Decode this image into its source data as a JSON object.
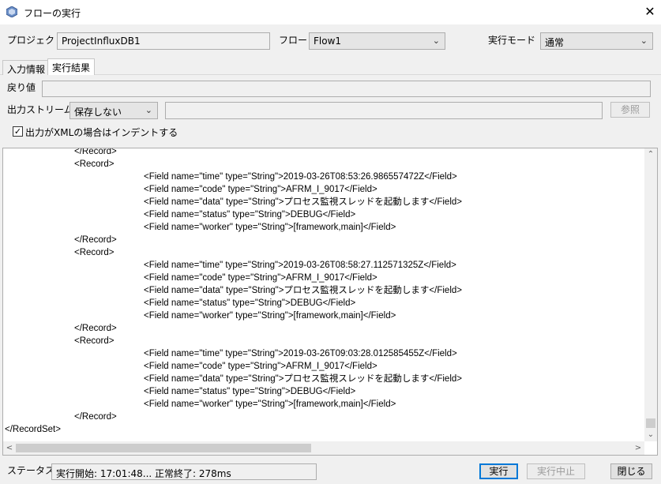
{
  "window": {
    "title": "フローの実行",
    "close_glyph": "✕"
  },
  "project": {
    "label": "プロジェクト",
    "value": "ProjectInfluxDB1"
  },
  "flow": {
    "label": "フロー",
    "value": "Flow1"
  },
  "mode": {
    "label": "実行モード",
    "value": "通常"
  },
  "tabs": [
    {
      "label": "入力情報",
      "active": false
    },
    {
      "label": "実行結果",
      "active": true
    }
  ],
  "return_value": {
    "label": "戻り値",
    "value": ""
  },
  "output_stream": {
    "label": "出力ストリーム",
    "value": "保存しない",
    "path": "",
    "browse_label": "参照"
  },
  "indent": {
    "label": "出力がXMLの場合はインデントする",
    "checked": true,
    "check_glyph": "✓"
  },
  "xml": {
    "lines": [
      {
        "indent": 1,
        "text": "</Record>"
      },
      {
        "indent": 1,
        "text": "<Record>"
      },
      {
        "indent": 2,
        "text": "<Field name=\"time\" type=\"String\">2019-03-26T08:53:26.986557472Z</Field>"
      },
      {
        "indent": 2,
        "text": "<Field name=\"code\" type=\"String\">AFRM_I_9017</Field>"
      },
      {
        "indent": 2,
        "text": "<Field name=\"data\" type=\"String\">プロセス監視スレッドを起動します</Field>"
      },
      {
        "indent": 2,
        "text": "<Field name=\"status\" type=\"String\">DEBUG</Field>"
      },
      {
        "indent": 2,
        "text": "<Field name=\"worker\" type=\"String\">[framework,main]</Field>"
      },
      {
        "indent": 1,
        "text": "</Record>"
      },
      {
        "indent": 1,
        "text": "<Record>"
      },
      {
        "indent": 2,
        "text": "<Field name=\"time\" type=\"String\">2019-03-26T08:58:27.112571325Z</Field>"
      },
      {
        "indent": 2,
        "text": "<Field name=\"code\" type=\"String\">AFRM_I_9017</Field>"
      },
      {
        "indent": 2,
        "text": "<Field name=\"data\" type=\"String\">プロセス監視スレッドを起動します</Field>"
      },
      {
        "indent": 2,
        "text": "<Field name=\"status\" type=\"String\">DEBUG</Field>"
      },
      {
        "indent": 2,
        "text": "<Field name=\"worker\" type=\"String\">[framework,main]</Field>"
      },
      {
        "indent": 1,
        "text": "</Record>"
      },
      {
        "indent": 1,
        "text": "<Record>"
      },
      {
        "indent": 2,
        "text": "<Field name=\"time\" type=\"String\">2019-03-26T09:03:28.012585455Z</Field>"
      },
      {
        "indent": 2,
        "text": "<Field name=\"code\" type=\"String\">AFRM_I_9017</Field>"
      },
      {
        "indent": 2,
        "text": "<Field name=\"data\" type=\"String\">プロセス監視スレッドを起動します</Field>"
      },
      {
        "indent": 2,
        "text": "<Field name=\"status\" type=\"String\">DEBUG</Field>"
      },
      {
        "indent": 2,
        "text": "<Field name=\"worker\" type=\"String\">[framework,main]</Field>"
      },
      {
        "indent": 1,
        "text": "</Record>"
      },
      {
        "indent": 0,
        "text": "</RecordSet>"
      }
    ]
  },
  "status": {
    "label": "ステータス",
    "value": "実行開始: 17:01:48... 正常終了: 278ms"
  },
  "buttons": {
    "run": "実行",
    "stop": "実行中止",
    "close": "閉じる"
  },
  "scroll": {
    "up": "⌃",
    "down": "⌄",
    "left": "<",
    "right": ">"
  }
}
